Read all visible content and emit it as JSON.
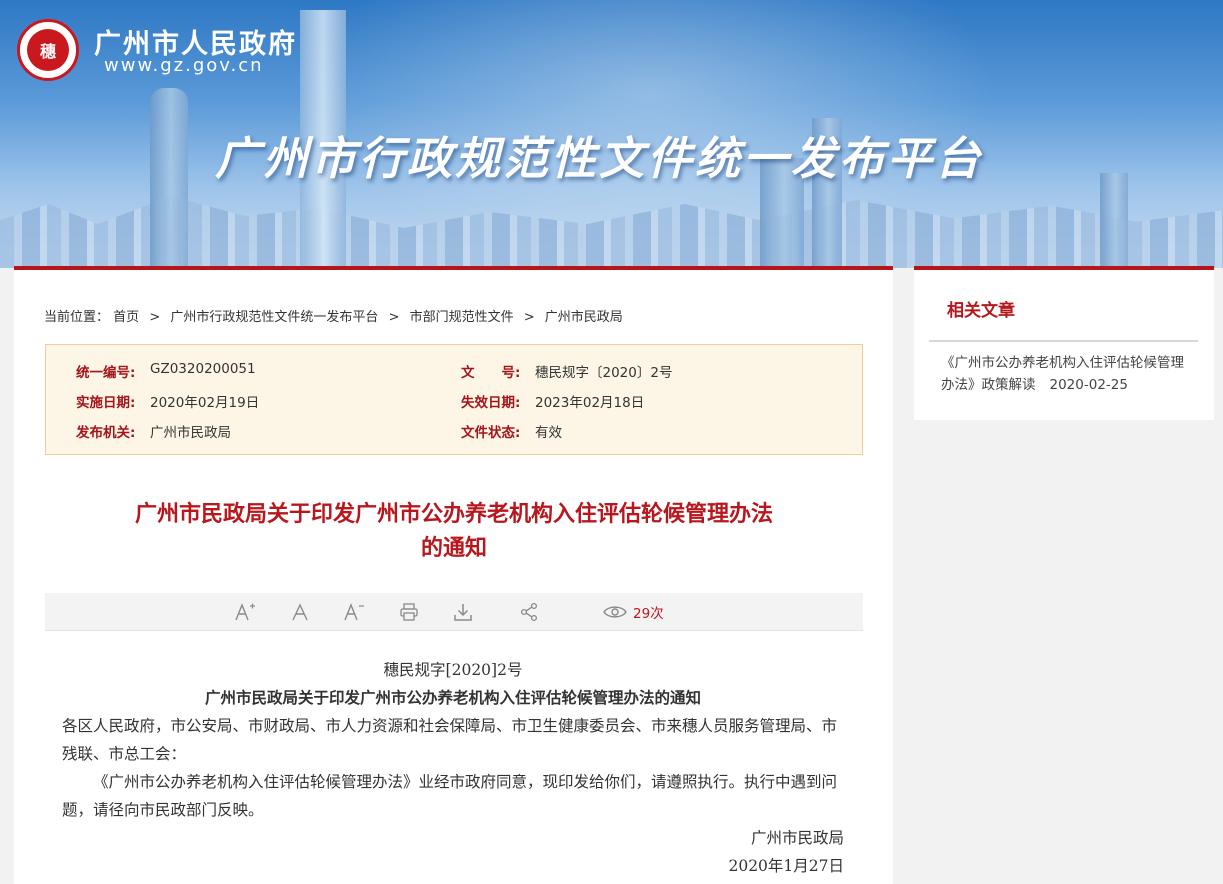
{
  "header": {
    "gov_name": "广州市人民政府",
    "gov_url": "www.gz.gov.cn",
    "emblem_text": "穗",
    "platform_title": "广州市行政规范性文件统一发布平台"
  },
  "breadcrumb": {
    "prefix": "当前位置：",
    "items": [
      "首页",
      "广州市行政规范性文件统一发布平台",
      "市部门规范性文件",
      "广州市民政局"
    ],
    "separator": ">"
  },
  "info": {
    "code_label": "统一编号:",
    "code_value": "GZ0320200051",
    "docno_label": "文　　号:",
    "docno_value": "穗民规字〔2020〕2号",
    "start_label": "实施日期:",
    "start_value": "2020年02月19日",
    "end_label": "失效日期:",
    "end_value": "2023年02月18日",
    "issuer_label": "发布机关:",
    "issuer_value": "广州市民政局",
    "status_label": "文件状态:",
    "status_value": "有效"
  },
  "document": {
    "title_line1": "广州市民政局关于印发广州市公办养老机构入住评估轮候管理办法",
    "title_line2": "的通知",
    "doc_number": "穗民规字[2020]2号",
    "notice_title": "广州市民政局关于印发广州市公办养老机构入住评估轮候管理办法的通知",
    "recipients": "各区人民政府，市公安局、市财政局、市人力资源和社会保障局、市卫生健康委员会、市来穗人员服务管理局、市残联、市总工会：",
    "body_paragraph": "《广州市公办养老机构入住评估轮候管理办法》业经市政府同意，现印发给你们，请遵照执行。执行中遇到问题，请径向市民政部门反映。",
    "signature": "广州市民政局",
    "date": "2020年1月27日"
  },
  "toolbar": {
    "font_increase_icon": "font-increase-icon",
    "font_normal_icon": "font-normal-icon",
    "font_decrease_icon": "font-decrease-icon",
    "print_icon": "print-icon",
    "download_icon": "download-icon",
    "share_icon": "share-icon",
    "views_count": "29次"
  },
  "sidebar": {
    "title": "相关文章",
    "items": [
      {
        "text": "《广州市公办养老机构入住评估轮候管理办法》政策解读",
        "date": "2020-02-25"
      }
    ]
  },
  "colors": {
    "accent": "#b8151b",
    "info_bg": "#fdf6e6",
    "info_border": "#f0ce99"
  }
}
